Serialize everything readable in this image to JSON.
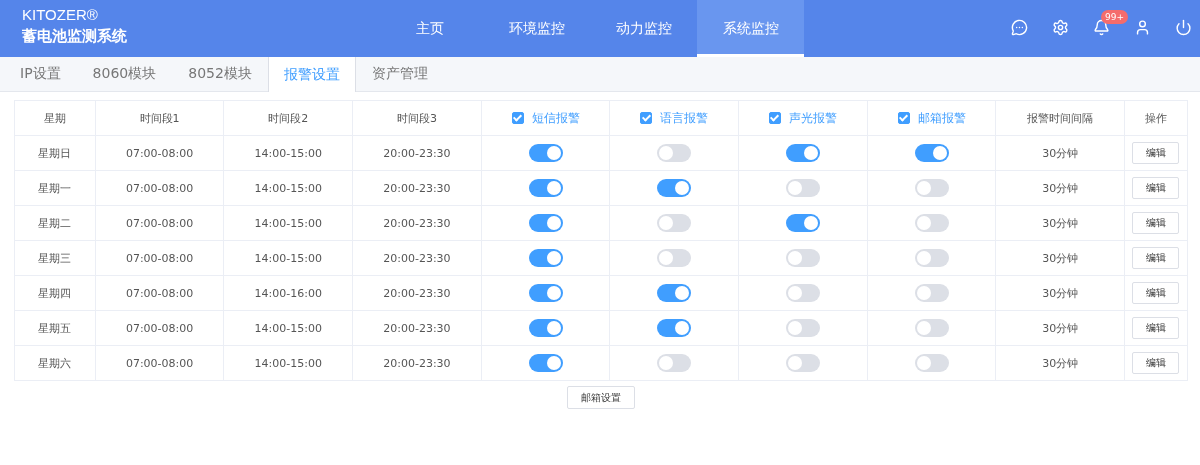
{
  "brand": {
    "name": "KITOZER®",
    "title": "蓄电池监测系统"
  },
  "nav": [
    {
      "label": "主页",
      "selected": false
    },
    {
      "label": "环境监控",
      "selected": false
    },
    {
      "label": "动力监控",
      "selected": false
    },
    {
      "label": "系统监控",
      "selected": true
    }
  ],
  "header_icons": [
    {
      "kind": "chat"
    },
    {
      "kind": "settings"
    },
    {
      "kind": "bell",
      "badge": "99+"
    },
    {
      "kind": "user"
    },
    {
      "kind": "power"
    }
  ],
  "subtabs": [
    {
      "label": "IP设置",
      "selected": false
    },
    {
      "label": "8060模块",
      "selected": false
    },
    {
      "label": "8052模块",
      "selected": false
    },
    {
      "label": "报警设置",
      "selected": true
    },
    {
      "label": "资产管理",
      "selected": false
    }
  ],
  "table": {
    "columns": [
      {
        "label": "星期",
        "kind": "text"
      },
      {
        "label": "时间段1",
        "kind": "text"
      },
      {
        "label": "时间段2",
        "kind": "text"
      },
      {
        "label": "时间段3",
        "kind": "text"
      },
      {
        "label": "短信报警",
        "kind": "check",
        "checked": true
      },
      {
        "label": "语言报警",
        "kind": "check",
        "checked": true
      },
      {
        "label": "声光报警",
        "kind": "check",
        "checked": true
      },
      {
        "label": "邮箱报警",
        "kind": "check",
        "checked": true
      },
      {
        "label": "报警时间间隔",
        "kind": "text"
      },
      {
        "label": "操作",
        "kind": "text"
      }
    ],
    "rows": [
      {
        "day": "星期日",
        "slot1": "07:00-08:00",
        "slot2": "14:00-15:00",
        "slot3": "20:00-23:30",
        "switches": [
          true,
          false,
          true,
          true
        ],
        "interval": "30分钟",
        "action": "编辑"
      },
      {
        "day": "星期一",
        "slot1": "07:00-08:00",
        "slot2": "14:00-15:00",
        "slot3": "20:00-23:30",
        "switches": [
          true,
          true,
          false,
          false
        ],
        "interval": "30分钟",
        "action": "编辑"
      },
      {
        "day": "星期二",
        "slot1": "07:00-08:00",
        "slot2": "14:00-15:00",
        "slot3": "20:00-23:30",
        "switches": [
          true,
          false,
          true,
          false
        ],
        "interval": "30分钟",
        "action": "编辑"
      },
      {
        "day": "星期三",
        "slot1": "07:00-08:00",
        "slot2": "14:00-15:00",
        "slot3": "20:00-23:30",
        "switches": [
          true,
          false,
          false,
          false
        ],
        "interval": "30分钟",
        "action": "编辑"
      },
      {
        "day": "星期四",
        "slot1": "07:00-08:00",
        "slot2": "14:00-16:00",
        "slot3": "20:00-23:30",
        "switches": [
          true,
          true,
          false,
          false
        ],
        "interval": "30分钟",
        "action": "编辑"
      },
      {
        "day": "星期五",
        "slot1": "07:00-08:00",
        "slot2": "14:00-15:00",
        "slot3": "20:00-23:30",
        "switches": [
          true,
          true,
          false,
          false
        ],
        "interval": "30分钟",
        "action": "编辑"
      },
      {
        "day": "星期六",
        "slot1": "07:00-08:00",
        "slot2": "14:00-15:00",
        "slot3": "20:00-23:30",
        "switches": [
          true,
          false,
          false,
          false
        ],
        "interval": "30分钟",
        "action": "编辑"
      }
    ]
  },
  "footer_button": "邮箱设置"
}
